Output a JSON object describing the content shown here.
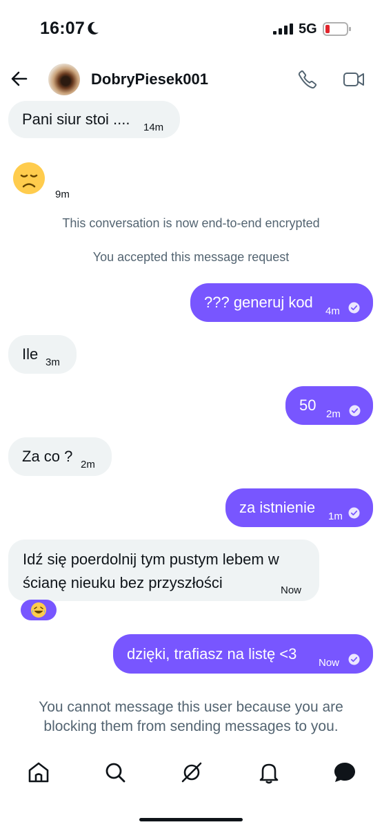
{
  "status_bar": {
    "time": "16:07",
    "network": "5G",
    "moon_icon": "moon-icon",
    "signal_icon": "signal-icon",
    "battery_icon": "battery-low-icon"
  },
  "header": {
    "contact_name": "DobryPiesek001",
    "back_icon": "arrow-left-icon",
    "call_icon": "phone-icon",
    "video_icon": "video-camera-icon"
  },
  "messages": [
    {
      "dir": "in",
      "text": "Pani siur stoi ....",
      "time": "14m"
    },
    {
      "dir": "in",
      "text": "😞",
      "time": "9m"
    },
    {
      "dir": "out",
      "text": "??? generuj kod",
      "time": "4m"
    },
    {
      "dir": "in",
      "text": "Ile",
      "time": "3m"
    },
    {
      "dir": "out",
      "text": "50",
      "time": "2m"
    },
    {
      "dir": "in",
      "text": "Za co ?",
      "time": "2m"
    },
    {
      "dir": "out",
      "text": "za istnienie",
      "time": "1m"
    },
    {
      "dir": "in",
      "text_line1": "Idź się poerdolnij tym pustym lebem w",
      "text_line2": "ścianę nieuku bez przyszłości",
      "time": "Now",
      "reaction": "😂"
    },
    {
      "dir": "out",
      "text": "dzięki, trafiasz na listę <3",
      "time": "Now"
    }
  ],
  "system": {
    "encrypted": "This conversation is now end-to-end encrypted",
    "accepted": "You accepted this message request"
  },
  "footer_note": "You cannot message this user because you are blocking them from sending messages to you.",
  "tabbar": {
    "items": [
      "home-icon",
      "search-icon",
      "grok-icon",
      "bell-icon",
      "messages-icon"
    ]
  },
  "colors": {
    "accent": "#7856ff",
    "incoming_bubble": "#eff3f4",
    "secondary_text": "#536471"
  }
}
